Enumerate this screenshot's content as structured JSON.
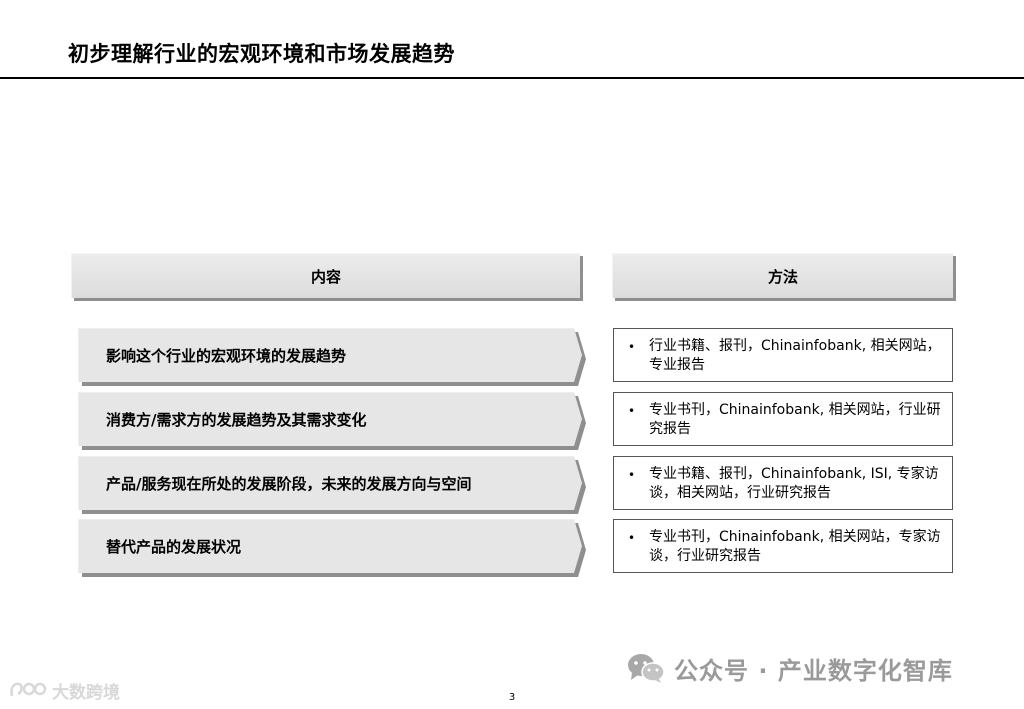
{
  "page": {
    "title": "初步理解行业的宏观环境和市场发展趋势",
    "page_number": "3"
  },
  "table": {
    "content_header": "内容",
    "method_header": "方法",
    "rows": [
      {
        "content": "影响这个行业的宏观环境的发展趋势",
        "method": "行业书籍、报刊，Chinainfobank, 相关网站，专业报告"
      },
      {
        "content": "消费方/需求方的发展趋势及其需求变化",
        "method": "专业书刊，Chinainfobank, 相关网站，行业研究报告"
      },
      {
        "content": "产品/服务现在所处的发展阶段，未来的发展方向与空间",
        "method": "专业书籍、报刊，Chinainfobank, ISI, 专家访谈，相关网站，行业研究报告"
      },
      {
        "content": "替代产品的发展状况",
        "method": "专业书刊，Chinainfobank, 相关网站，专家访谈，行业研究报告"
      }
    ],
    "bullet": "•"
  },
  "footer": {
    "wechat_text": "公众号 · 产业数字化智库",
    "watermark_text": "大数跨境"
  },
  "icons": {
    "wechat": "wechat-icon",
    "watermark_logo": "watermark-logo-icon"
  },
  "colors": {
    "header_fill": "#dcdcdc",
    "arrow_fill": "#e6e6e6",
    "shadow": "#8f8f8f",
    "rule": "#000000"
  }
}
